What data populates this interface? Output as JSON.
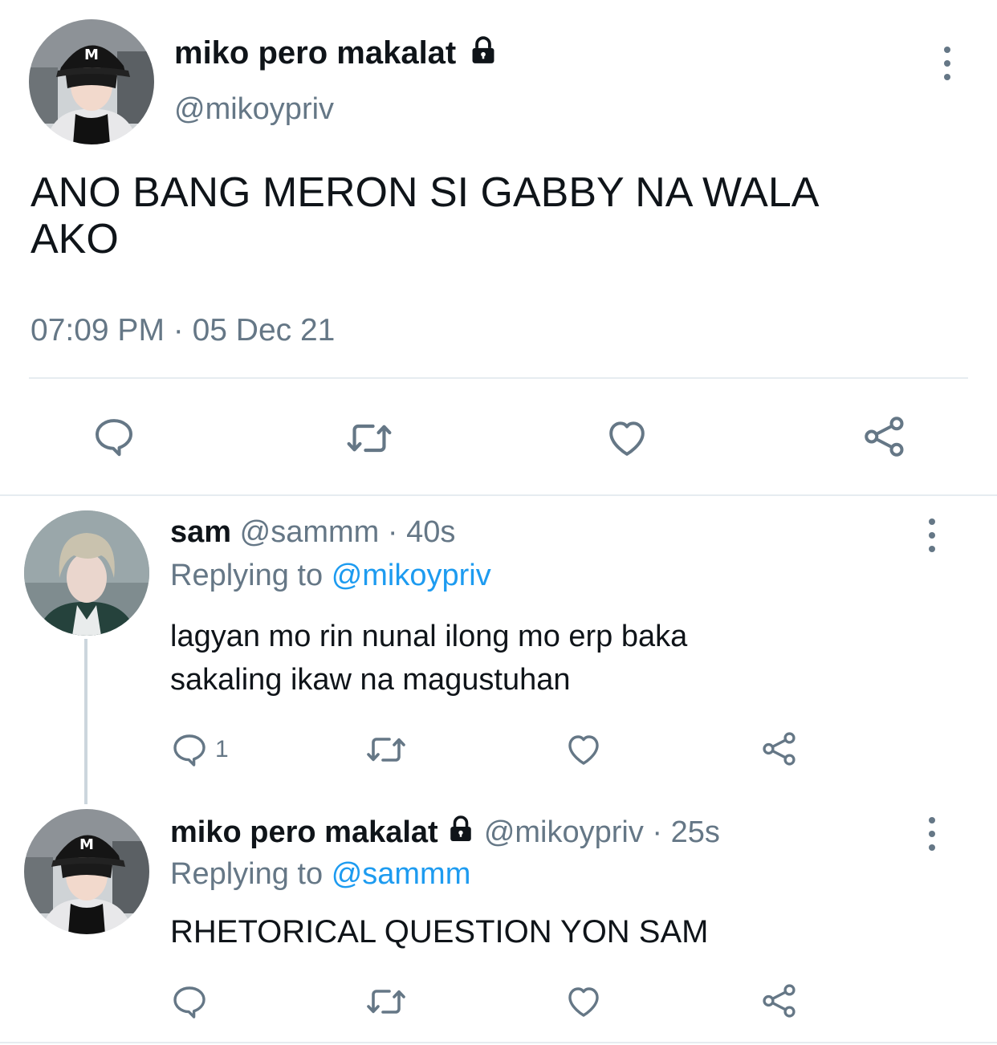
{
  "main_tweet": {
    "display_name": "miko pero makalat",
    "handle": "@mikoypriv",
    "text_line1": "ANO BANG MERON SI GABBY NA WALA",
    "text_line2": "AKO",
    "timestamp": "07:09 PM · 05 Dec 21"
  },
  "reply1": {
    "display_name": "sam",
    "handle": "@sammm",
    "time": "· 40s",
    "replying_prefix": "Replying to",
    "replying_to": "@mikoypriv",
    "text_line1": "lagyan mo rin nunal ilong mo erp baka",
    "text_line2": "sakaling ikaw na magustuhan",
    "reply_count": "1"
  },
  "reply2": {
    "display_name": "miko pero makalat",
    "handle": "@mikoypriv",
    "time": "· 25s",
    "replying_prefix": "Replying to",
    "replying_to": "@sammm",
    "text": "RHETORICAL QUESTION YON SAM"
  },
  "icons": {
    "reply": "reply-icon",
    "retweet": "retweet-icon",
    "like": "heart-icon",
    "share": "share-icon",
    "more": "more-icon",
    "lock": "lock-icon"
  },
  "colors": {
    "text": "#0f1419",
    "muted": "#657786",
    "link": "#1d9bf0",
    "divider": "#e6ecf0"
  }
}
